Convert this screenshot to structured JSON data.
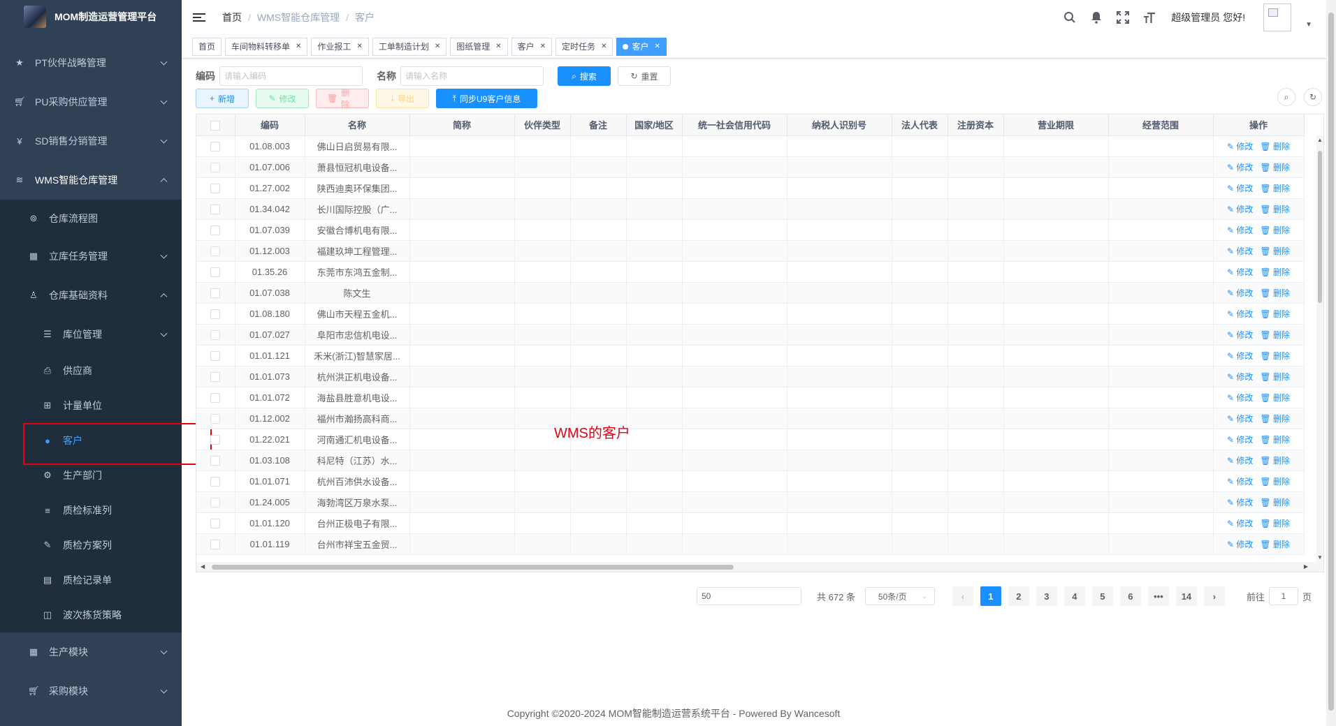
{
  "app": {
    "title": "MOM制造运营管理平台"
  },
  "sidebar": {
    "items": [
      {
        "label": "PT伙伴战略管理",
        "icon": "star-icon"
      },
      {
        "label": "PU采购供应管理",
        "icon": "cart-icon"
      },
      {
        "label": "SD销售分销管理",
        "icon": "yen-icon"
      },
      {
        "label": "WMS智能仓库管理",
        "icon": "layers-icon"
      },
      {
        "label": "仓库流程图",
        "icon": "compass-icon"
      },
      {
        "label": "立库任务管理",
        "icon": "grid-icon"
      },
      {
        "label": "仓库基础资料",
        "icon": "person-icon"
      },
      {
        "label": "库位管理",
        "icon": "list-icon"
      },
      {
        "label": "供应商",
        "icon": "supplier-icon"
      },
      {
        "label": "计量单位",
        "icon": "unit-icon"
      },
      {
        "label": "客户",
        "icon": "customer-icon"
      },
      {
        "label": "生产部门",
        "icon": "gear-icon"
      },
      {
        "label": "质检标准列",
        "icon": "doc-list-icon"
      },
      {
        "label": "质检方案列",
        "icon": "edit-icon"
      },
      {
        "label": "质检记录单",
        "icon": "record-icon"
      },
      {
        "label": "波次拣货策略",
        "icon": "columns-icon"
      },
      {
        "label": "生产模块",
        "icon": "grid-icon"
      },
      {
        "label": "采购模块",
        "icon": "cart-icon"
      }
    ]
  },
  "breadcrumb": [
    "首页",
    "WMS智能仓库管理",
    "客户"
  ],
  "header": {
    "greeting": "超级管理员 您好!"
  },
  "tags": [
    "首页",
    "车间物料转移单",
    "作业报工",
    "工单制造计划",
    "图纸管理",
    "客户",
    "定时任务",
    "客户"
  ],
  "search": {
    "code_label": "编码",
    "code_placeholder": "请输入编码",
    "name_label": "名称",
    "name_placeholder": "请输入名称",
    "search_btn": "搜索",
    "reset_btn": "重置"
  },
  "toolbar": {
    "add": "新增",
    "edit": "修改",
    "delete": "删除",
    "export": "导出",
    "sync": "同步U9客户信息"
  },
  "table": {
    "columns": [
      "编码",
      "名称",
      "简称",
      "伙伴类型",
      "备注",
      "国家/地区",
      "统一社会信用代码",
      "纳税人识别号",
      "法人代表",
      "注册资本",
      "营业期限",
      "经营范围",
      "操作"
    ],
    "op_edit": "修改",
    "op_delete": "删除",
    "rows": [
      [
        "01.08.003",
        "佛山日启贸易有限..."
      ],
      [
        "01.07.006",
        "萧县恒冠机电设备..."
      ],
      [
        "01.27.002",
        "陕西迪奥环保集团..."
      ],
      [
        "01.34.042",
        "长川国际控股（广..."
      ],
      [
        "01.07.039",
        "安徽合博机电有限..."
      ],
      [
        "01.12.003",
        "福建玖坤工程管理..."
      ],
      [
        "01.35.26",
        "东莞市东鸿五金制..."
      ],
      [
        "01.07.038",
        "陈文生"
      ],
      [
        "01.08.180",
        "佛山市天程五金机..."
      ],
      [
        "01.07.027",
        "阜阳市忠信机电设..."
      ],
      [
        "01.01.121",
        "禾米(浙江)智慧家居..."
      ],
      [
        "01.01.073",
        "杭州洪正机电设备..."
      ],
      [
        "01.01.072",
        "海盐县胜意机电设..."
      ],
      [
        "01.12.002",
        "福州市瀚扬高科商..."
      ],
      [
        "01.22.021",
        "河南通汇机电设备..."
      ],
      [
        "01.03.108",
        "科尼特（江苏）水..."
      ],
      [
        "01.01.071",
        "杭州百沛供水设备..."
      ],
      [
        "01.24.005",
        "海勃湾区万泉水泵..."
      ],
      [
        "01.01.120",
        "台州正极电子有限..."
      ],
      [
        "01.01.119",
        "台州市祥宝五金贸..."
      ]
    ]
  },
  "annotation": "WMS的客户",
  "pagination": {
    "jump_value": "50",
    "total": "共 672 条",
    "page_size": "50条/页",
    "pages": [
      "1",
      "2",
      "3",
      "4",
      "5",
      "6",
      "•••",
      "14"
    ],
    "current_page": 1,
    "goto_label": "前往",
    "goto_value": "1",
    "goto_suffix": "页"
  },
  "footer": "Copyright ©2020-2024 MOM智能制造运营系统平台 - Powered By Wancesoft"
}
